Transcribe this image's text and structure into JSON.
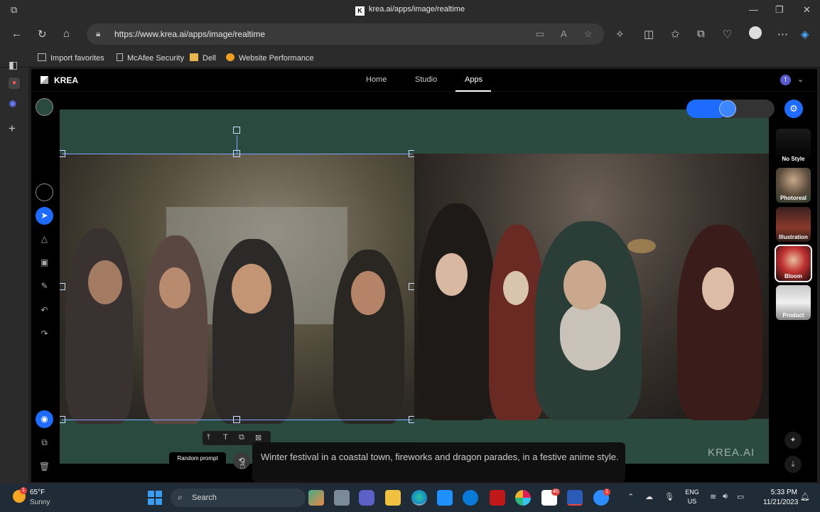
{
  "browser": {
    "window_title": "krea.ai/apps/image/realtime",
    "url": "https://www.krea.ai/apps/image/realtime",
    "favorites": [
      "Import favorites",
      "McAfee Security",
      "Dell",
      "Website Performance"
    ]
  },
  "app": {
    "logo": "KREA",
    "nav": [
      "Home",
      "Studio",
      "Apps"
    ],
    "active_nav": "Apps",
    "avatar_initial": "T",
    "styles": [
      "No Style",
      "Photoreal",
      "Illustration",
      "Bloom",
      "Product"
    ],
    "selected_style": "Bloom",
    "ai_strength_fraction": 0.37,
    "watermark": "KREA.AI",
    "random_prompt_tooltip": "Random prompt",
    "prompt": "Winter festival in a coastal town, fireworks and dragon parades, in a festive anime style."
  },
  "taskbar": {
    "weather_temp": "65°F",
    "weather_cond": "Sunny",
    "weather_badge": "1",
    "search_label": "Search",
    "lang_line1": "ENG",
    "lang_line2": "US",
    "time": "5:33 PM",
    "date": "11/21/2023",
    "teams_badge": "40",
    "zoom_badge": "1"
  },
  "colors": {
    "accent": "#1e6bff",
    "canvas_bg": "#2a4a3f",
    "taskbar": "#1f2b36"
  }
}
